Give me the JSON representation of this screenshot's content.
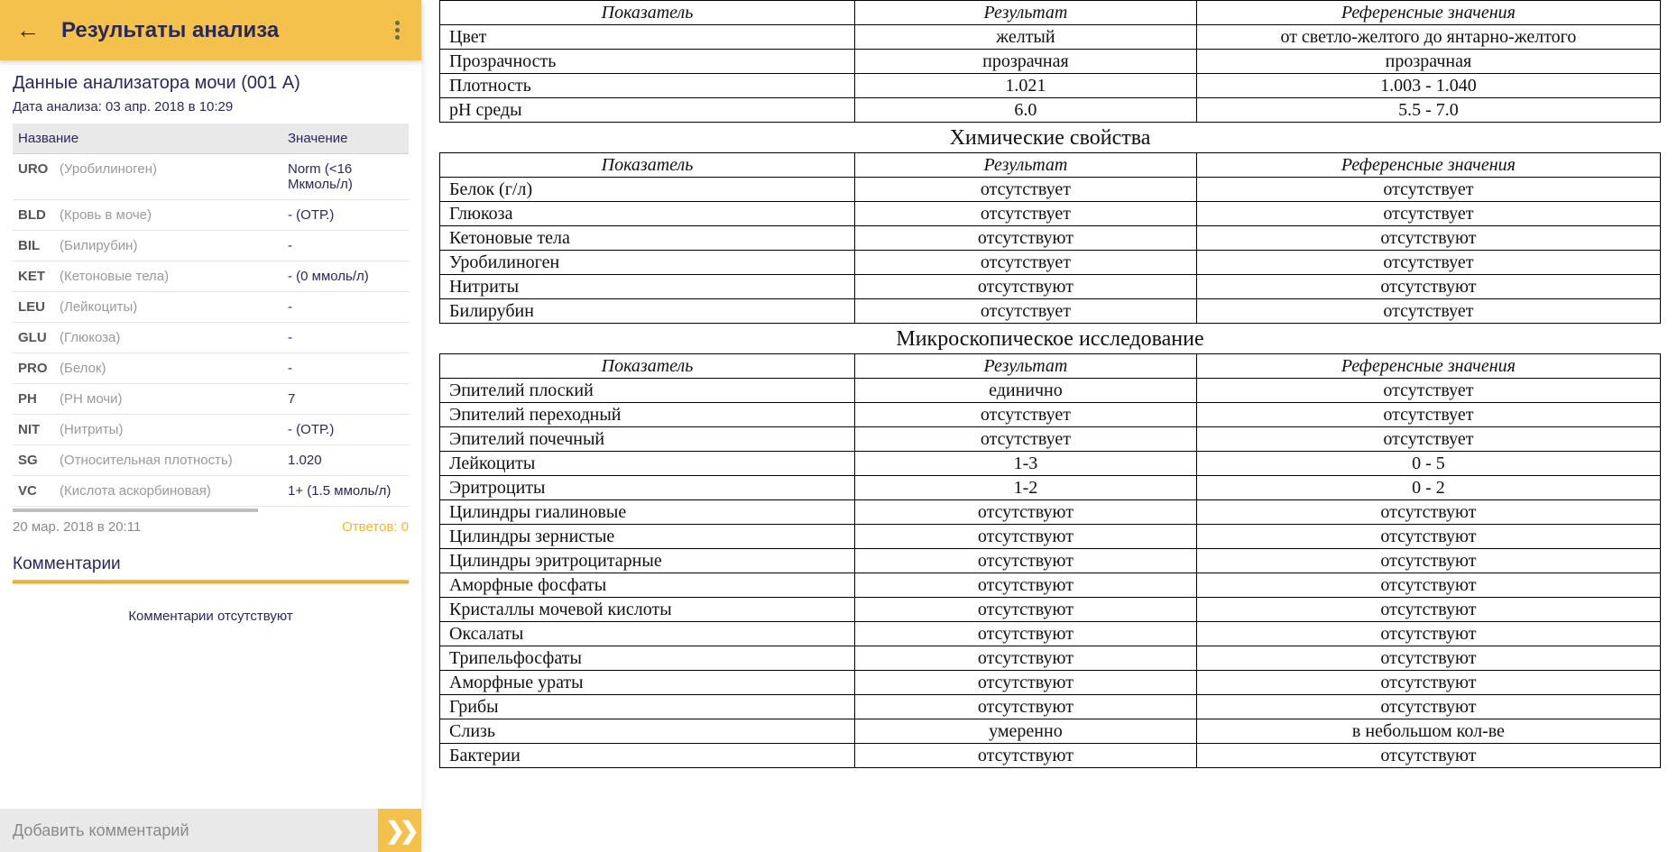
{
  "app": {
    "title": "Результаты анализа",
    "section_title": "Данные анализатора мочи (001 A)",
    "analysis_date": "Дата анализа: 03 апр. 2018 в 10:29",
    "table_headers": {
      "name": "Название",
      "value": "Значение"
    },
    "rows": [
      {
        "code": "URO",
        "name": "(Уробилиноген)",
        "value": "Norm (<16 Мкмоль/л)"
      },
      {
        "code": "BLD",
        "name": "(Кровь в моче)",
        "value": "- (ОТР.)"
      },
      {
        "code": "BIL",
        "name": "(Билирубин)",
        "value": "-"
      },
      {
        "code": "KET",
        "name": "(Кетоновые тела)",
        "value": "- (0 ммоль/л)"
      },
      {
        "code": "LEU",
        "name": "(Лейкоциты)",
        "value": "-"
      },
      {
        "code": "GLU",
        "name": "(Глюкоза)",
        "value": "-"
      },
      {
        "code": "PRO",
        "name": "(Белок)",
        "value": "-"
      },
      {
        "code": "PH",
        "name": "(PH мочи)",
        "value": "7"
      },
      {
        "code": "NIT",
        "name": "(Нитриты)",
        "value": "- (ОТР.)"
      },
      {
        "code": "SG",
        "name": "(Относительная плотность)",
        "value": "1.020"
      },
      {
        "code": "VC",
        "name": "(Кислота аскорбиновая)",
        "value": "1+ (1.5 ммоль/л)"
      }
    ],
    "meta_date": "20 мар. 2018 в 20:11",
    "answers_label": "Ответов: 0",
    "comments_title": "Комментарии",
    "no_comments": "Комментарии отсутствуют",
    "comment_placeholder": "Добавить комментарий"
  },
  "report": {
    "headers": {
      "indicator": "Показатель",
      "result": "Результат",
      "reference": "Референсные значения"
    },
    "physical": [
      {
        "ind": "Цвет",
        "res": "желтый",
        "ref": "от светло-желтого до янтарно-желтого"
      },
      {
        "ind": "Прозрачность",
        "res": "прозрачная",
        "ref": "прозрачная"
      },
      {
        "ind": "Плотность",
        "res": "1.021",
        "ref": "1.003 - 1.040"
      },
      {
        "ind": "pH среды",
        "res": "6.0",
        "ref": "5.5 - 7.0"
      }
    ],
    "chemical_title": "Химические свойства",
    "chemical": [
      {
        "ind": "Белок (г/л)",
        "res": "отсутствует",
        "ref": "отсутствует"
      },
      {
        "ind": "Глюкоза",
        "res": "отсутствует",
        "ref": "отсутствует"
      },
      {
        "ind": "Кетоновые тела",
        "res": "отсутствуют",
        "ref": "отсутствуют"
      },
      {
        "ind": "Уробилиноген",
        "res": "отсутствует",
        "ref": "отсутствует"
      },
      {
        "ind": "Нитриты",
        "res": "отсутствуют",
        "ref": "отсутствуют"
      },
      {
        "ind": "Билирубин",
        "res": "отсутствует",
        "ref": "отсутствует"
      }
    ],
    "micro_title": "Микроскопическое исследование",
    "micro": [
      {
        "ind": "Эпителий плоский",
        "res": "единично",
        "ref": "отсутствует"
      },
      {
        "ind": "Эпителий переходный",
        "res": "отсутствует",
        "ref": "отсутствует"
      },
      {
        "ind": "Эпителий почечный",
        "res": "отсутствует",
        "ref": "отсутствует"
      },
      {
        "ind": "Лейкоциты",
        "res": "1-3",
        "ref": "0 - 5"
      },
      {
        "ind": "Эритроциты",
        "res": "1-2",
        "ref": "0 - 2"
      },
      {
        "ind": "Цилиндры гиалиновые",
        "res": "отсутствуют",
        "ref": "отсутствуют"
      },
      {
        "ind": "Цилиндры зернистые",
        "res": "отсутствуют",
        "ref": "отсутствуют"
      },
      {
        "ind": "Цилиндры эритроцитарные",
        "res": "отсутствуют",
        "ref": "отсутствуют"
      },
      {
        "ind": "Аморфные фосфаты",
        "res": "отсутствуют",
        "ref": "отсутствуют"
      },
      {
        "ind": "Кристаллы мочевой кислоты",
        "res": "отсутствуют",
        "ref": "отсутствуют"
      },
      {
        "ind": "Оксалаты",
        "res": "отсутствуют",
        "ref": "отсутствуют"
      },
      {
        "ind": "Трипельфосфаты",
        "res": "отсутствуют",
        "ref": "отсутствуют"
      },
      {
        "ind": "Аморфные ураты",
        "res": "отсутствуют",
        "ref": "отсутствуют"
      },
      {
        "ind": "Грибы",
        "res": "отсутствуют",
        "ref": "отсутствуют"
      },
      {
        "ind": "Слизь",
        "res": "умеренно",
        "ref": "в небольшом кол-ве"
      },
      {
        "ind": "Бактерии",
        "res": "отсутствуют",
        "ref": "отсутствуют"
      }
    ]
  }
}
